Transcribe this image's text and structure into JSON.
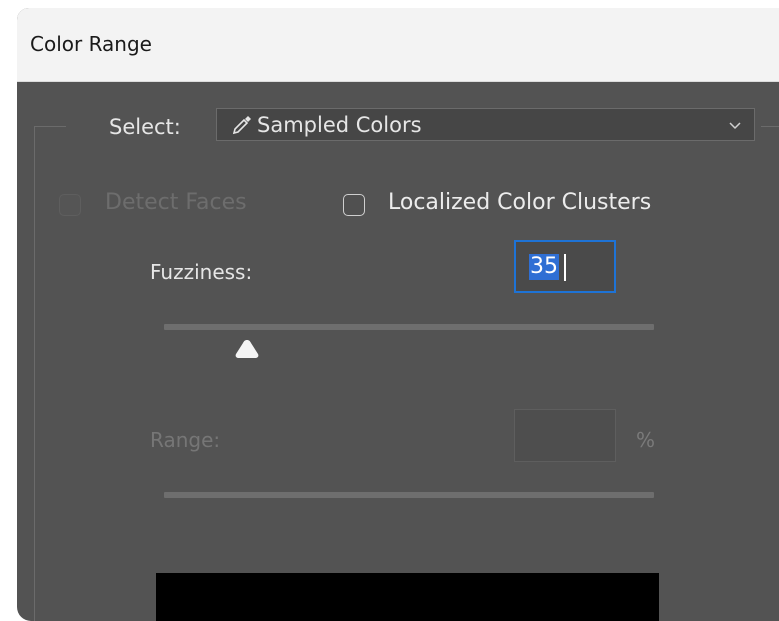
{
  "window": {
    "title": "Color Range"
  },
  "select": {
    "label": "Select:",
    "value": "Sampled Colors",
    "icon": "eyedropper-icon"
  },
  "options": {
    "detect_faces": {
      "label": "Detect Faces",
      "checked": false,
      "enabled": false
    },
    "localized_clusters": {
      "label": "Localized Color Clusters",
      "checked": false,
      "enabled": true
    }
  },
  "fuzziness": {
    "label": "Fuzziness:",
    "value": "35",
    "slider_max": 200
  },
  "range": {
    "label": "Range:",
    "value": "",
    "unit": "%",
    "enabled": false
  },
  "colors": {
    "panel_bg": "#535353",
    "accent": "#1e73d6",
    "preview_bg": "#000000"
  }
}
